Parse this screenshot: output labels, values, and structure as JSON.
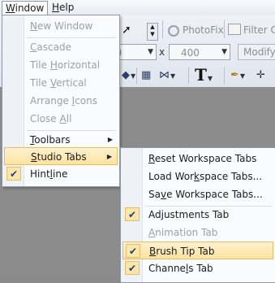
{
  "menubar": {
    "window_label_pre": "",
    "window_label_u": "W",
    "window_label_post": "indow",
    "help_label_u": "H",
    "help_label_post": "elp"
  },
  "toolbar": {
    "photofix_label": "PhotoFix",
    "filter_label": "Filter G",
    "spin1_value": "00",
    "x_label": "x",
    "spin2_value": "400",
    "modify_label": "Modify"
  },
  "window_menu": {
    "items": [
      {
        "pre": "",
        "u": "N",
        "post": "ew Window"
      },
      {
        "pre": "",
        "u": "C",
        "post": "ascade"
      },
      {
        "pre": "Tile ",
        "u": "H",
        "post": "orizontal"
      },
      {
        "pre": "Tile ",
        "u": "V",
        "post": "ertical"
      },
      {
        "pre": "Arrange ",
        "u": "I",
        "post": "cons"
      },
      {
        "pre": "Close ",
        "u": "A",
        "post": "ll"
      },
      {
        "pre": "",
        "u": "T",
        "post": "oolbars"
      },
      {
        "pre": "",
        "u": "S",
        "post": "tudio Tabs"
      },
      {
        "pre": "Hint",
        "u": "l",
        "post": "ine"
      }
    ]
  },
  "studio_menu": {
    "items": [
      {
        "pre": "",
        "u": "R",
        "post": "eset Workspace Tabs"
      },
      {
        "pre": "Load Wor",
        "u": "k",
        "post": "space Tabs..."
      },
      {
        "pre": "Sa",
        "u": "v",
        "post": "e Workspace Tabs..."
      },
      {
        "pre": "Adjustments Tab",
        "u": "",
        "post": ""
      },
      {
        "pre": "",
        "u": "A",
        "post": "nimation Tab"
      },
      {
        "pre": "",
        "u": "B",
        "post": "rush Tip Tab"
      },
      {
        "pre": "Channe",
        "u": "l",
        "post": "s Tab"
      }
    ]
  },
  "icons": {
    "check": "✔",
    "submenu_arrow": "▶"
  }
}
